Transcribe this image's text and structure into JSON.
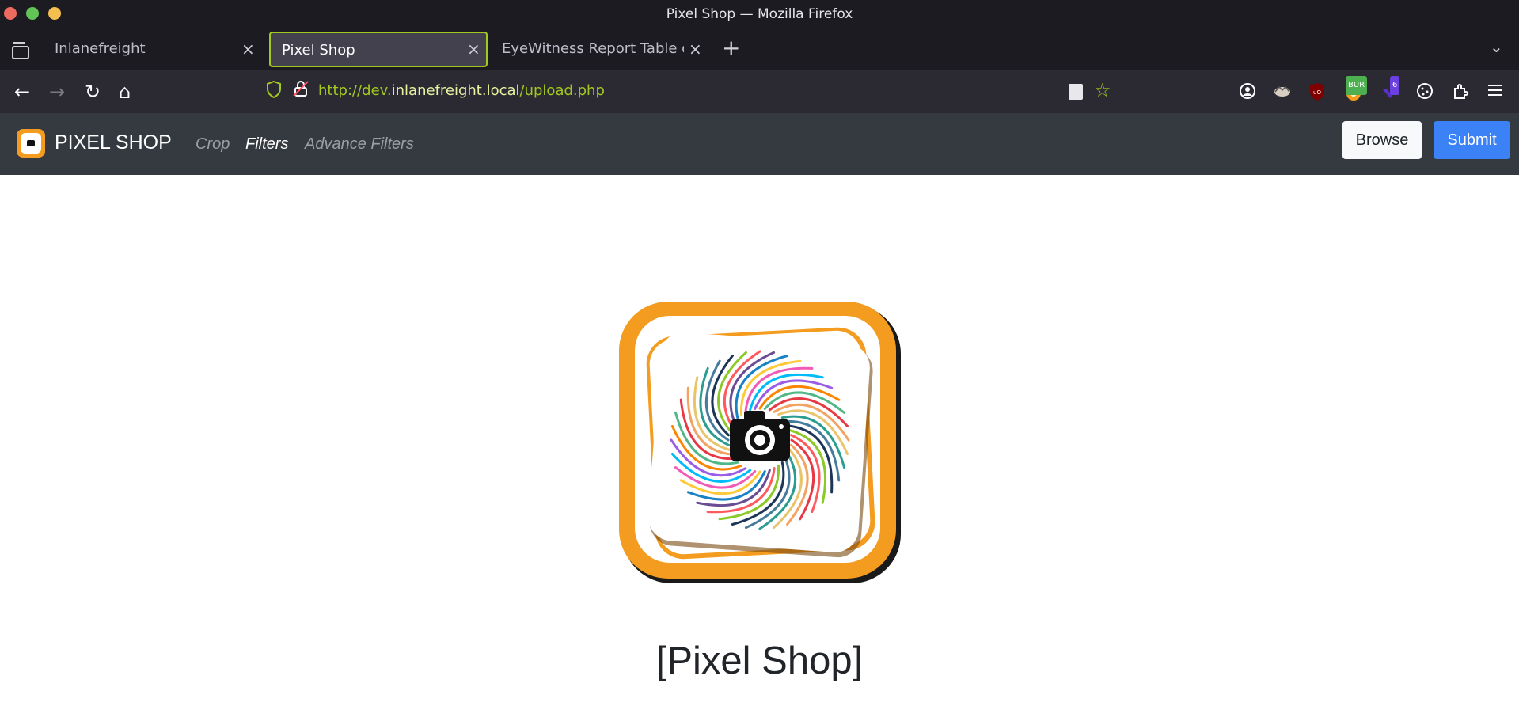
{
  "window": {
    "title": "Pixel Shop — Mozilla Firefox"
  },
  "tabs": [
    {
      "label": "Inlanefreight",
      "close": "×",
      "active": false
    },
    {
      "label": "Pixel Shop",
      "close": "×",
      "active": true
    },
    {
      "label": "EyeWitness Report Table of C",
      "close": "×",
      "active": false
    }
  ],
  "tab_controls": {
    "new_tab": "+",
    "list_all": "⌄"
  },
  "navbar": {
    "back": "←",
    "forward": "→",
    "reload": "↻",
    "home": "⌂",
    "url_scheme_sub": "http://dev.",
    "url_host": "inlanefreight.local",
    "url_path": "/upload.php",
    "extensions": [
      {
        "icon": "account-icon"
      },
      {
        "icon": "foxyproxy-icon"
      },
      {
        "icon": "ublock-icon"
      },
      {
        "icon": "burp-icon",
        "badge": "BUR"
      },
      {
        "icon": "wappalyzer-icon",
        "badge": "6"
      },
      {
        "icon": "cookie-icon"
      },
      {
        "icon": "extensions-icon"
      },
      {
        "icon": "menu-icon"
      }
    ]
  },
  "site": {
    "brand": "PIXEL SHOP",
    "links": [
      {
        "label": "Crop",
        "active": false
      },
      {
        "label": "Filters",
        "active": true
      },
      {
        "label": "Advance Filters",
        "active": false
      }
    ],
    "browse_label": "Browse",
    "submit_label": "Submit",
    "heading": "[Pixel Shop]"
  },
  "colors": {
    "accent_green": "#a3c91e",
    "navbar_dark": "#343a40",
    "submit_blue": "#3b82f6",
    "logo_orange": "#f39c1f"
  }
}
